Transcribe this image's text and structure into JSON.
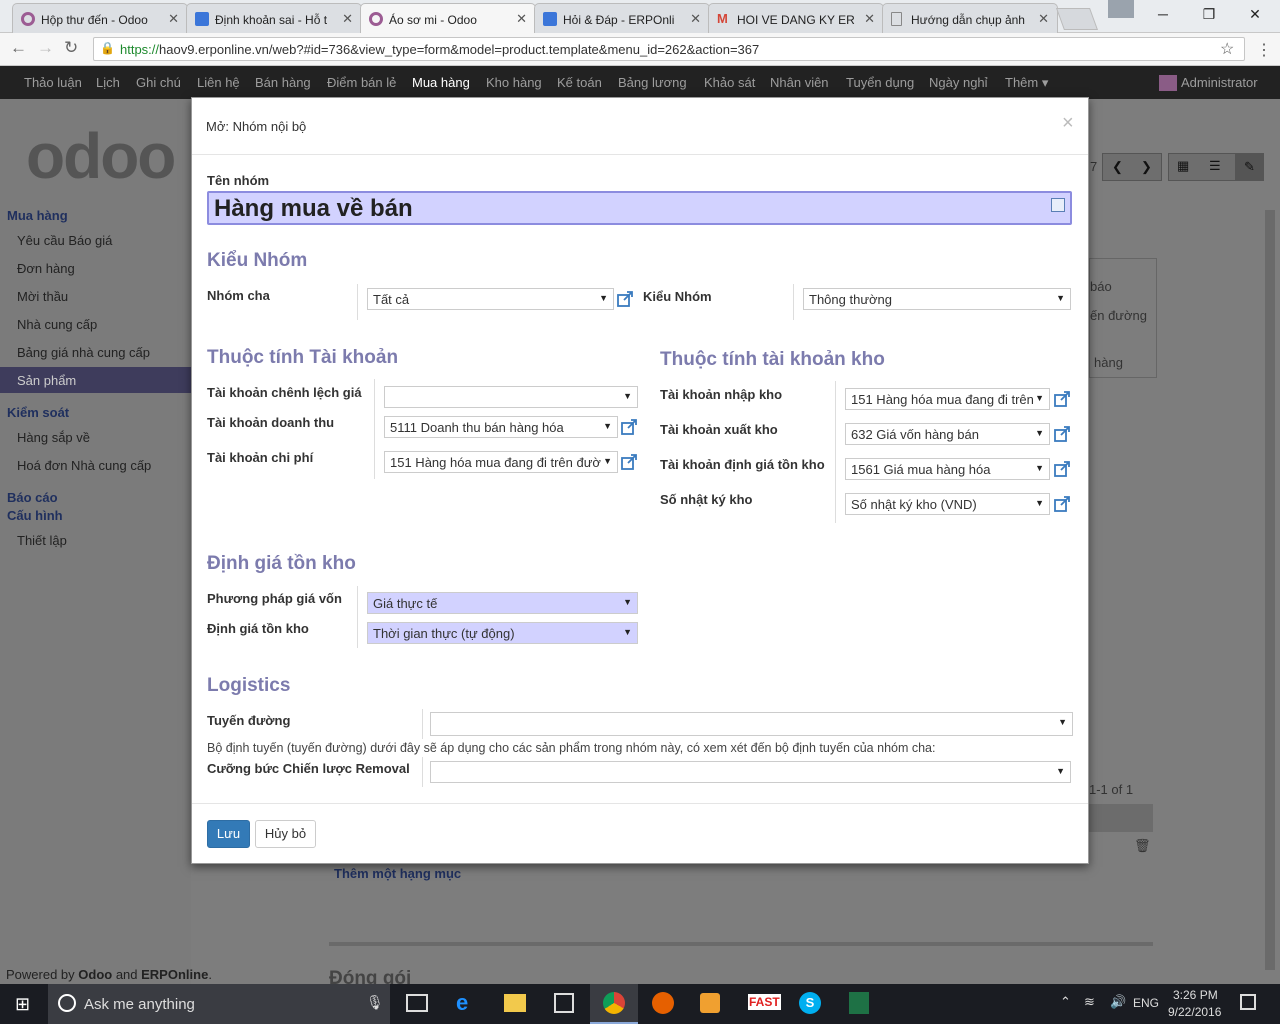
{
  "browser": {
    "tabs": [
      {
        "title": "Hộp thư đến - Odoo",
        "color": "#9c5c93"
      },
      {
        "title": "Định khoản sai - Hỗ t",
        "color": "#3b76d9"
      },
      {
        "title": "Áo sơ mi - Odoo",
        "color": "#9c5c93"
      },
      {
        "title": "Hỏi & Đáp - ERPOnli",
        "color": "#3b76d9"
      },
      {
        "title": "HOI VE DANG KY ER",
        "color": "#d44638"
      },
      {
        "title": "Hướng dẫn chụp ảnh",
        "color": "#888888"
      }
    ],
    "url_secure": "https://",
    "url_rest": "haov9.erponline.vn/web?#id=736&view_type=form&model=product.template&menu_id=262&action=367"
  },
  "topnav": {
    "items": [
      "Thảo luận",
      "Lịch",
      "Ghi chú",
      "Liên hệ",
      "Bán hàng",
      "Điểm bán lẻ",
      "Mua hàng",
      "Kho hàng",
      "Kế toán",
      "Bảng lương",
      "Khảo sát",
      "Nhân viên",
      "Tuyển dụng",
      "Ngày nghỉ",
      "Thêm"
    ],
    "active": "Mua hàng",
    "user": "Administrator"
  },
  "sidebar": {
    "logo": "odoo",
    "h1": "Mua hàng",
    "group1": [
      "Yêu cầu Báo giá",
      "Đơn hàng",
      "Mời thầu",
      "Nhà cung cấp",
      "Bảng giá nhà cung cấp",
      "Sản phẩm"
    ],
    "h2": "Kiểm soát",
    "group2": [
      "Hàng sắp về",
      "Hoá đơn Nhà cung cấp"
    ],
    "h3": "Báo cáo",
    "h4": "Cấu hình",
    "group3": [
      "Thiết lập"
    ],
    "footer_a": "Powered by ",
    "footer_b": "Odoo",
    "footer_c": " and ",
    "footer_d": "ERPOnline",
    "footer_e": "."
  },
  "background": {
    "pager": "7",
    "snip1": "báo",
    "snip2": "ến đường",
    "snip3": "hàng",
    "count": "1-1 of 1",
    "add_line": "Thêm một hạng mục",
    "packing": "Đóng gói"
  },
  "modal": {
    "title": "Mở: Nhóm nội bộ",
    "name_label": "Tên nhóm",
    "name_value": "Hàng mua về bán",
    "sec_type": "Kiểu Nhóm",
    "parent_label": "Nhóm cha",
    "parent_value": "Tất cả",
    "type_label": "Kiểu Nhóm",
    "type_value": "Thông thường",
    "sec_acc": "Thuộc tính Tài khoản",
    "acc_diff_label": "Tài khoản chênh lệch giá",
    "acc_diff_value": "",
    "acc_income_label": "Tài khoản doanh thu",
    "acc_income_value": "5111 Doanh thu bán hàng hóa",
    "acc_exp_label": "Tài khoản chi phí",
    "acc_exp_value": "151 Hàng hóa mua đang đi trên đườ",
    "sec_stock": "Thuộc tính tài khoản kho",
    "in_label": "Tài khoản nhập kho",
    "in_value": "151 Hàng hóa mua đang đi trên",
    "out_label": "Tài khoản xuất kho",
    "out_value": "632 Giá vốn hàng bán",
    "val_label": "Tài khoản định giá tồn kho",
    "val_value": "1561 Giá mua hàng hóa",
    "journal_label": "Số nhật ký kho",
    "journal_value": "Số nhật ký kho (VND)",
    "sec_valuation": "Định giá tồn kho",
    "cost_label": "Phương pháp giá vốn",
    "cost_value": "Giá thực tế",
    "inv_label": "Định giá tồn kho",
    "inv_value": "Thời gian thực (tự động)",
    "sec_log": "Logistics",
    "route_label": "Tuyến đường",
    "route_value": "",
    "route_help": "Bộ định tuyến (tuyến đường) dưới đây sẽ áp dụng cho các sản phẩm trong nhóm này, có xem xét đến bộ định tuyến của nhóm cha:",
    "removal_label": "Cưỡng bức Chiến lược Removal",
    "removal_value": "",
    "save": "Lưu",
    "cancel": "Hủy bỏ"
  },
  "taskbar": {
    "search": "Ask me anything",
    "lang": "ENG",
    "time": "3:26 PM",
    "date": "9/22/2016"
  },
  "colors": {
    "accent": "#7c7bad",
    "primary_btn": "#337ab7",
    "required_bg": "#d2d2ff"
  }
}
